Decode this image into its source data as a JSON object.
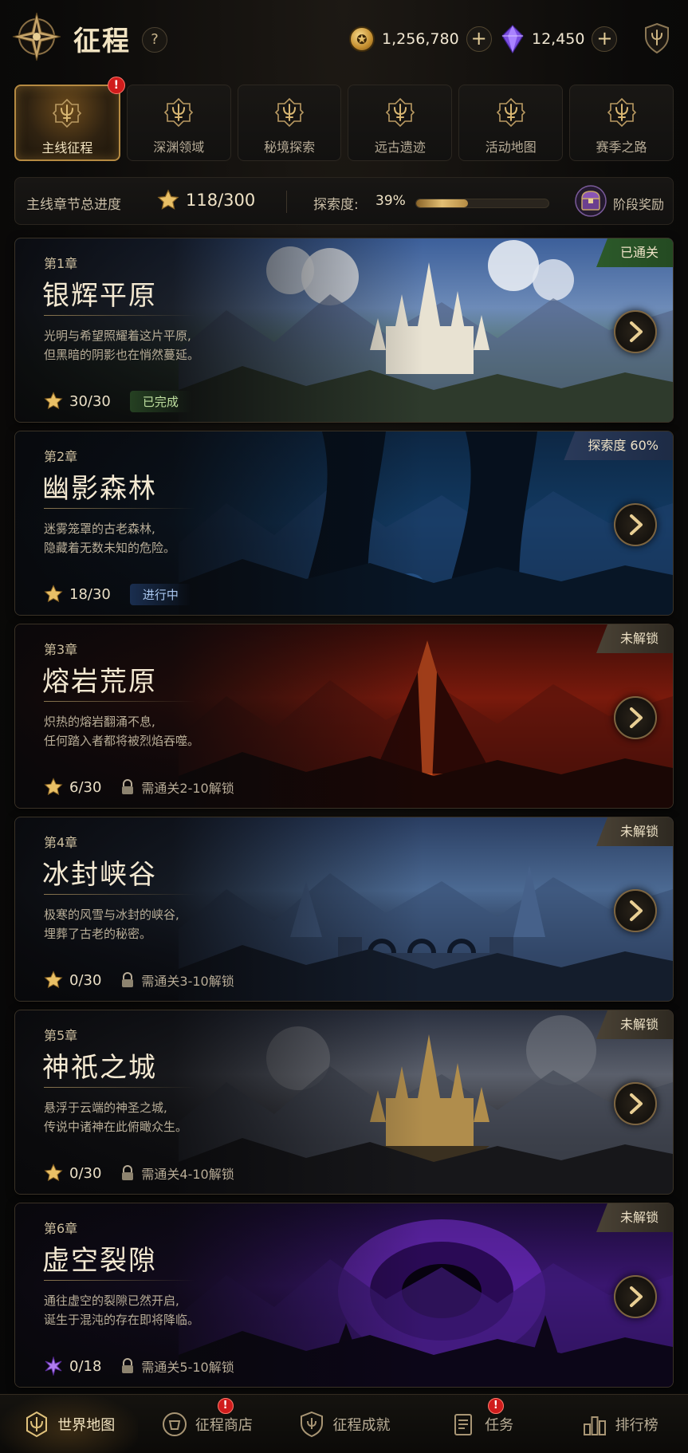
{
  "header": {
    "title": "征程",
    "help_label": "?",
    "gold": {
      "value": "1,256,780",
      "add_label": "+",
      "icon": "gold-coin-icon"
    },
    "gems": {
      "value": "12,450",
      "add_label": "+",
      "icon": "purple-gem-icon"
    },
    "settings_icon": "shield-emblem-icon"
  },
  "tabs": [
    {
      "label": "主线征程",
      "active": true,
      "badge": "!",
      "icon": "trident-emblem-icon"
    },
    {
      "label": "深渊领域",
      "active": false,
      "icon": "abyss-emblem-icon"
    },
    {
      "label": "秘境探索",
      "active": false,
      "icon": "realm-emblem-icon"
    },
    {
      "label": "远古遗迹",
      "active": false,
      "icon": "ruins-emblem-icon"
    },
    {
      "label": "活动地图",
      "active": false,
      "icon": "event-map-emblem-icon"
    },
    {
      "label": "赛季之路",
      "active": false,
      "icon": "season-emblem-icon"
    }
  ],
  "progress": {
    "label": "主线章节总进度",
    "stars": "118/300",
    "explore_label": "探索度:",
    "explore_value": "39%",
    "explore_fraction": 0.39,
    "reward_label": "阶段奖励"
  },
  "chapters": [
    {
      "no": "第1章",
      "name": "银辉平原",
      "desc1": "光明与希望照耀着这片平原,",
      "desc2": "但黑暗的阴影也在悄然蔓延。",
      "stars": "30/30",
      "status": "已完成",
      "tag": "已通关",
      "theme": "sky"
    },
    {
      "no": "第2章",
      "name": "幽影森林",
      "desc1": "迷雾笼罩的古老森林,",
      "desc2": "隐藏着无数未知的危险。",
      "stars": "18/30",
      "status": "进行中",
      "tag": "探索度 60%",
      "theme": "forest"
    },
    {
      "no": "第3章",
      "name": "熔岩荒原",
      "desc1": "炽热的熔岩翻涌不息,",
      "desc2": "任何踏入者都将被烈焰吞噬。",
      "stars": "6/30",
      "lock": "需通关2-10解锁",
      "tag": "未解锁",
      "theme": "lava"
    },
    {
      "no": "第4章",
      "name": "冰封峡谷",
      "desc1": "极寒的风雪与冰封的峡谷,",
      "desc2": "埋葬了古老的秘密。",
      "stars": "0/30",
      "lock": "需通关3-10解锁",
      "tag": "未解锁",
      "theme": "ice"
    },
    {
      "no": "第5章",
      "name": "神祇之城",
      "desc1": "悬浮于云端的神圣之城,",
      "desc2": "传说中诸神在此俯瞰众生。",
      "stars": "0/30",
      "lock": "需通关4-10解锁",
      "tag": "未解锁",
      "theme": "city"
    },
    {
      "no": "第6章",
      "name": "虚空裂隙",
      "desc1": "通往虚空的裂隙已然开启,",
      "desc2": "诞生于混沌的存在即将降临。",
      "stars": "0/18",
      "lock": "需通关5-10解锁",
      "tag": "未解锁",
      "theme": "void"
    }
  ],
  "bottom_nav": [
    {
      "label": "世界地图",
      "active": true,
      "icon": "world-map-icon"
    },
    {
      "label": "征程商店",
      "active": false,
      "badge": "!",
      "icon": "shop-icon"
    },
    {
      "label": "征程成就",
      "active": false,
      "icon": "achievement-icon"
    },
    {
      "label": "任务",
      "active": false,
      "badge": "!",
      "icon": "quest-scroll-icon"
    },
    {
      "label": "排行榜",
      "active": false,
      "icon": "ranking-icon"
    }
  ],
  "colors": {
    "accent_gold": "#d9b772",
    "badge_red": "#d01c1c",
    "done_green": "#2c5a2a",
    "progress_blue": "#2a3a5a"
  }
}
